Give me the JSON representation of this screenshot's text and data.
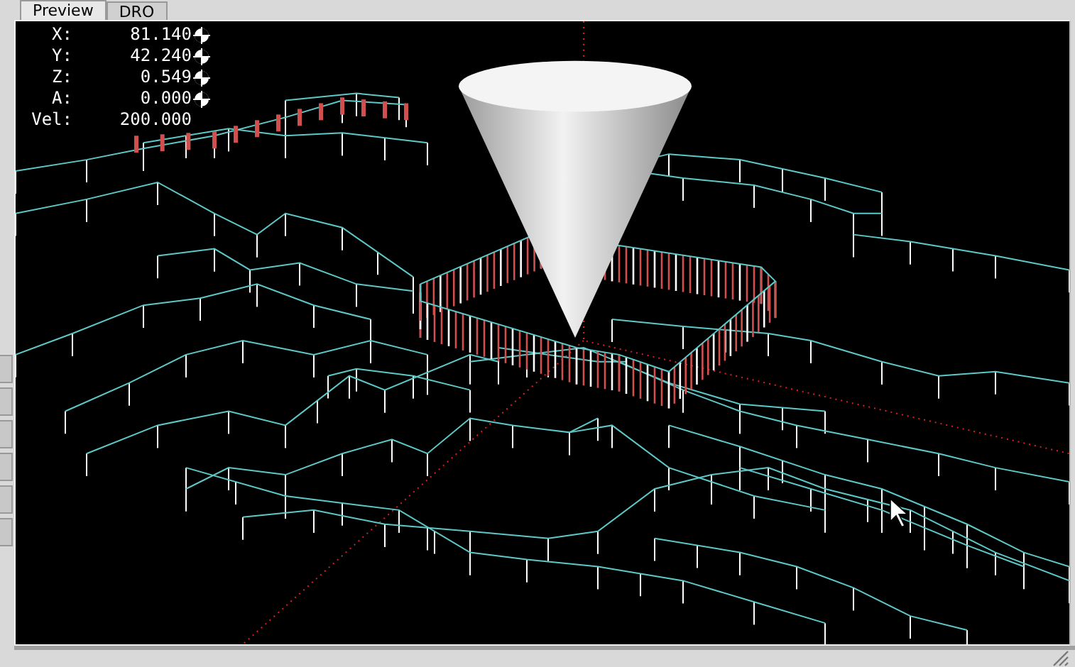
{
  "tabs": [
    {
      "label": "Preview",
      "selected": true
    },
    {
      "label": "DRO",
      "selected": false
    }
  ],
  "dro": [
    {
      "kind": "axis",
      "label": "X:",
      "value": "81.140",
      "homed": true
    },
    {
      "kind": "axis",
      "label": "Y:",
      "value": "42.240",
      "homed": true
    },
    {
      "kind": "axis",
      "label": "Z:",
      "value": "0.549",
      "homed": true
    },
    {
      "kind": "axis",
      "label": "A:",
      "value": "0.000",
      "homed": true
    },
    {
      "kind": "velocity",
      "label": "Vel:",
      "value": "200.000"
    }
  ]
}
